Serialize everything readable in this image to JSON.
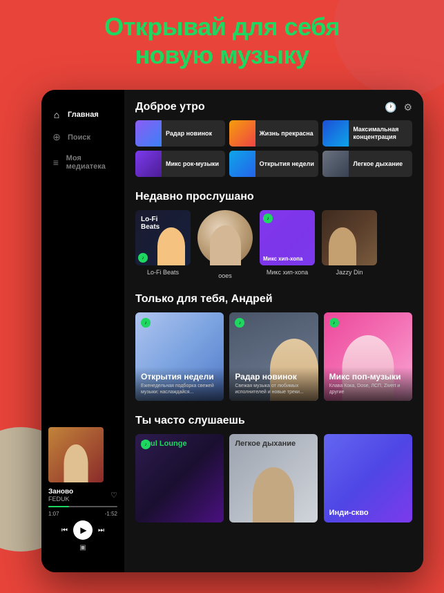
{
  "header": {
    "line1": "Открывай для себя",
    "line2": "новую музыку"
  },
  "sidebar": {
    "items": [
      {
        "id": "home",
        "label": "Главная",
        "icon": "🏠",
        "active": true
      },
      {
        "id": "search",
        "label": "Поиск",
        "icon": "🔍",
        "active": false
      },
      {
        "id": "library",
        "label": "Моя медиатека",
        "icon": "📚",
        "active": false
      }
    ]
  },
  "player": {
    "title": "Заново",
    "artist": "FEDUK",
    "time_current": "1:07",
    "time_total": "-1:52",
    "progress": 30
  },
  "main": {
    "greeting": "Доброе утро",
    "quick_items": [
      {
        "id": "radar",
        "label": "Радар новинок",
        "color": "radar"
      },
      {
        "id": "life",
        "label": "Жизнь прекрасна",
        "color": "life"
      },
      {
        "id": "maxconc",
        "label": "Максимальная концентрация",
        "color": "maxconc"
      },
      {
        "id": "rockmix",
        "label": "Микс рок-музыки",
        "color": "rockmix"
      },
      {
        "id": "discovery",
        "label": "Открытия недели",
        "color": "discovery"
      },
      {
        "id": "breathe",
        "label": "Легкое дыхание",
        "color": "breathe"
      }
    ],
    "recently_section": "Недавно прослушано",
    "recently": [
      {
        "id": "lofi",
        "name": "Lo-Fi Beats",
        "type": "lofi"
      },
      {
        "id": "ooes",
        "name": "ooes",
        "type": "person"
      },
      {
        "id": "hiphop",
        "name": "Микс хип-хопа",
        "type": "hiphop"
      },
      {
        "id": "jazzy",
        "name": "Jazzy Din",
        "type": "jazzy"
      }
    ],
    "foryou_section": "Только для тебя, Андрей",
    "foryou": [
      {
        "id": "discovery-week",
        "title": "Открытия недели",
        "desc": "Еженедельная подборка свежей музыки: наслаждайся...",
        "type": "discovery"
      },
      {
        "id": "radar-new",
        "title": "Радар новинок",
        "desc": "Свежая музыка от любимых исполнителей и новые треки...",
        "type": "radar"
      },
      {
        "id": "pop-mix",
        "title": "Микс поп-музыки",
        "desc": "Клава Кока, Dose, ЛСП, Zivert и другие",
        "type": "pop"
      }
    ],
    "often_section": "Ты часто слушаешь",
    "often": [
      {
        "id": "soul-lounge",
        "label": "Soul Lounge",
        "type": "soul"
      },
      {
        "id": "breathe-easy",
        "label": "Легкое дыхание",
        "type": "breathe-img"
      },
      {
        "id": "indie",
        "label": "Инди-скво",
        "type": "indie"
      }
    ]
  }
}
